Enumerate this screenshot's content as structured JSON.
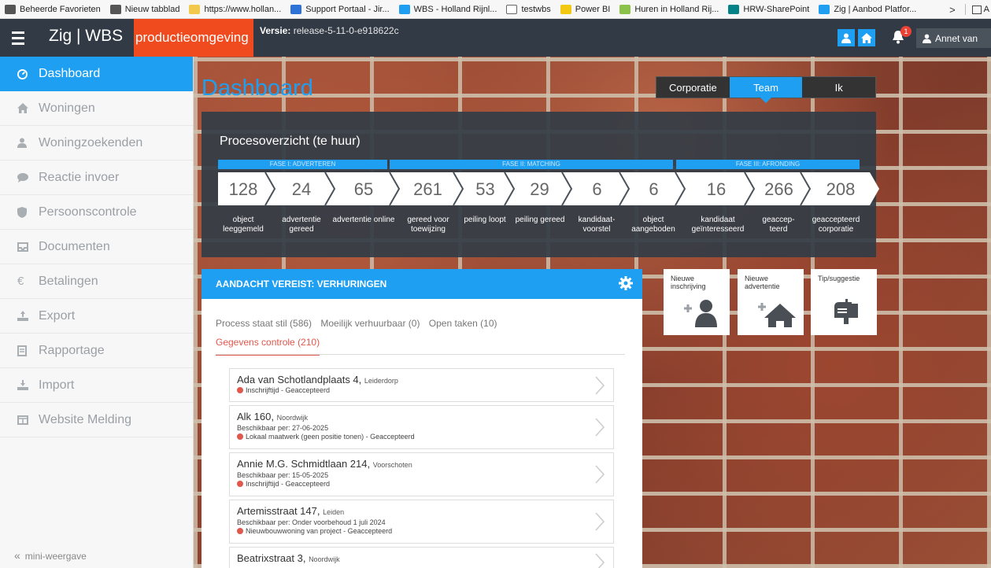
{
  "favorites": [
    {
      "label": "Beheerde Favorieten",
      "color": "#555"
    },
    {
      "label": "Nieuw tabblad",
      "color": "#555"
    },
    {
      "label": "https://www.hollan...",
      "color": "#f2c94c"
    },
    {
      "label": "Support Portaal - Jir...",
      "color": "#2d72d9"
    },
    {
      "label": "WBS - Holland Rijnl...",
      "color": "#1e9ff2"
    },
    {
      "label": "testwbs",
      "color": "#666"
    },
    {
      "label": "Power BI",
      "color": "#f2c811"
    },
    {
      "label": "Huren in Holland Rij...",
      "color": "#8bc34a"
    },
    {
      "label": "HRW-SharePoint",
      "color": "#038387"
    },
    {
      "label": "Zig | Aanbod Platfor...",
      "color": "#1e9ff2"
    }
  ],
  "favbar_overflow": ">",
  "favbar_trailing": "A",
  "topnav": {
    "brand": "Zig | WBS",
    "environment": "productieomgeving",
    "version_label": "Versie:",
    "version_value": "release-5-11-0-e918622c",
    "notification_count": "1",
    "user_name": "Annet van"
  },
  "sidebar": {
    "items": [
      {
        "label": "Dashboard",
        "icon": "dashboard-icon"
      },
      {
        "label": "Woningen",
        "icon": "home-icon"
      },
      {
        "label": "Woningzoekenden",
        "icon": "user-icon"
      },
      {
        "label": "Reactie invoer",
        "icon": "chat-icon"
      },
      {
        "label": "Persoonscontrole",
        "icon": "shield-icon"
      },
      {
        "label": "Documenten",
        "icon": "inbox-icon"
      },
      {
        "label": "Betalingen",
        "icon": "euro-icon"
      },
      {
        "label": "Export",
        "icon": "export-icon"
      },
      {
        "label": "Rapportage",
        "icon": "report-icon"
      },
      {
        "label": "Import",
        "icon": "import-icon"
      },
      {
        "label": "Website Melding",
        "icon": "website-icon"
      }
    ],
    "mini_icon": "«",
    "mini_label": "mini-weergave"
  },
  "dashboard": {
    "title": "Dashboard",
    "segments": [
      "Corporatie",
      "Team",
      "Ik"
    ],
    "active_segment": "Team"
  },
  "process": {
    "title": "Procesoverzicht (te huur)",
    "phases": [
      "FASE I: ADVERTEREN",
      "FASE II: MATCHING",
      "FASE III: AFRONDING"
    ],
    "steps": [
      {
        "value": "128",
        "label": "object leeggemeld"
      },
      {
        "value": "24",
        "label": "advertentie gereed"
      },
      {
        "value": "65",
        "label": "advertentie online"
      },
      {
        "value": "261",
        "label": "gereed voor toewijzing"
      },
      {
        "value": "53",
        "label": "peiling loopt"
      },
      {
        "value": "29",
        "label": "peiling gereed"
      },
      {
        "value": "6",
        "label": "kandidaat-voorstel"
      },
      {
        "value": "6",
        "label": "object aangeboden"
      },
      {
        "value": "16",
        "label": "kandidaat geïnteresseerd"
      },
      {
        "value": "266",
        "label": "geaccep-teerd"
      },
      {
        "value": "208",
        "label": "geaccepteerd corporatie"
      }
    ]
  },
  "attention": {
    "title": "AANDACHT VEREIST: VERHURINGEN",
    "filters": [
      "Process staat stil (586)",
      "Moeilijk verhuurbaar (0)",
      "Open taken (10)"
    ],
    "active_filter": "Gegevens controle (210)",
    "rows": [
      {
        "street": "Ada van Schotlandplaats 4,",
        "city": "Leiderdorp",
        "date": "",
        "status": "Inschrijftijd - Geaccepteerd"
      },
      {
        "street": "Alk 160,",
        "city": "Noordwijk",
        "date": "Beschikbaar per: 27-06-2025",
        "status": "Lokaal maatwerk (geen positie tonen) - Geaccepteerd"
      },
      {
        "street": "Annie M.G. Schmidtlaan 214,",
        "city": "Voorschoten",
        "date": "Beschikbaar per: 15-05-2025",
        "status": "Inschrijftijd - Geaccepteerd"
      },
      {
        "street": "Artemisstraat 147,",
        "city": "Leiden",
        "date": "Beschikbaar per: Onder voorbehoud 1 juli 2024",
        "status": "Nieuwbouwwoning van project - Geaccepteerd"
      },
      {
        "street": "Beatrixstraat 3,",
        "city": "Noordwijk",
        "date": "",
        "status": ""
      }
    ]
  },
  "tiles": [
    {
      "label": "Nieuwe inschrijving",
      "icon": "add-user-icon"
    },
    {
      "label": "Nieuwe advertentie",
      "icon": "add-home-icon"
    },
    {
      "label": "Tip/suggestie",
      "icon": "mailbox-icon"
    }
  ]
}
